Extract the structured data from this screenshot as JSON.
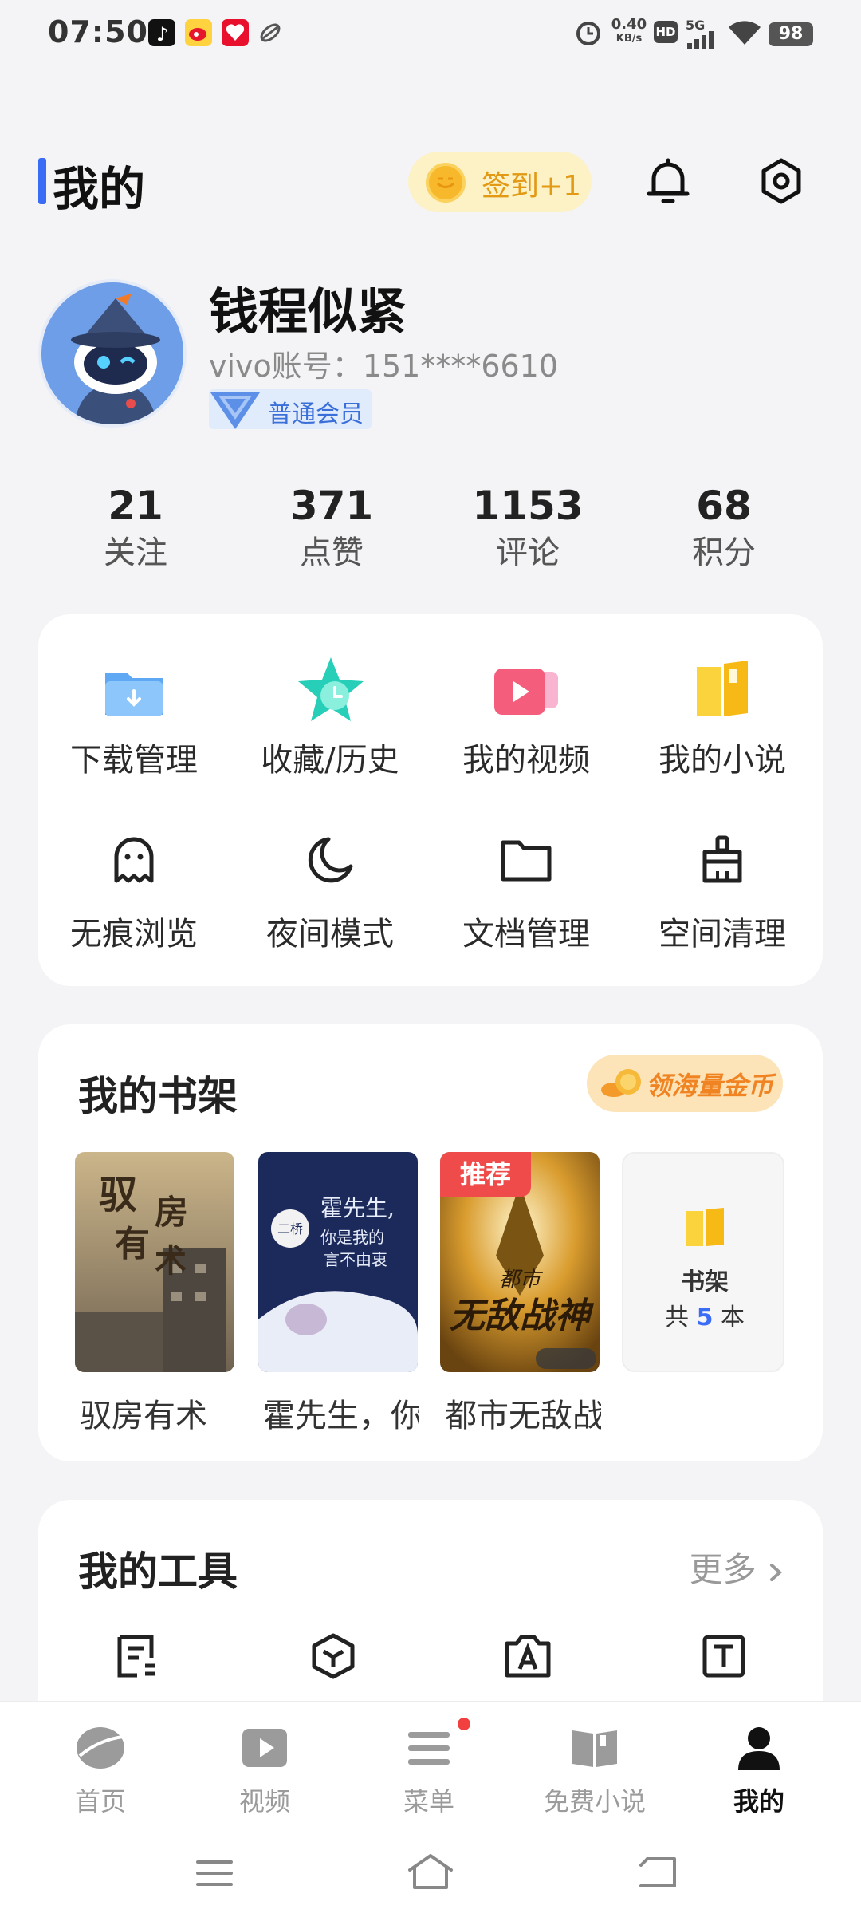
{
  "status_bar": {
    "time": "07:50",
    "net_speed_value": "0.40",
    "net_speed_unit": "KB/s",
    "hd_label": "HD",
    "signal_label": "5G",
    "battery": "98"
  },
  "header": {
    "title": "我的",
    "signin_label": "签到+1"
  },
  "profile": {
    "name": "钱程似紧",
    "account": "vivo账号：151****6610",
    "vip_label": "普通会员"
  },
  "stats": [
    {
      "value": "21",
      "label": "关注"
    },
    {
      "value": "371",
      "label": "点赞"
    },
    {
      "value": "1153",
      "label": "评论"
    },
    {
      "value": "68",
      "label": "积分"
    }
  ],
  "quick_grid": [
    {
      "label": "下载管理",
      "icon": "download-folder-icon"
    },
    {
      "label": "收藏/历史",
      "icon": "star-clock-icon"
    },
    {
      "label": "我的视频",
      "icon": "video-icon"
    },
    {
      "label": "我的小说",
      "icon": "book-icon"
    },
    {
      "label": "无痕浏览",
      "icon": "ghost-icon"
    },
    {
      "label": "夜间模式",
      "icon": "moon-icon"
    },
    {
      "label": "文档管理",
      "icon": "folder-icon"
    },
    {
      "label": "空间清理",
      "icon": "broom-icon"
    }
  ],
  "bookshelf": {
    "title": "我的书架",
    "gold_btn": "领海量金币",
    "books": [
      {
        "title": "驭房有术",
        "cover_text": "驭房有术"
      },
      {
        "title": "霍先生，你是我的言不由衷",
        "cover_text": "霍先生，你是我的言不由衷",
        "cover_author": "二桥"
      },
      {
        "title": "都市无敌战神",
        "cover_text": "都市无敌战神",
        "badge": "推荐",
        "cover_top": "都市",
        "cover_main": "无敌战神"
      }
    ],
    "shelf_card": {
      "title": "书架",
      "prefix": "共",
      "count": "5",
      "suffix": "本"
    }
  },
  "tools": {
    "title": "我的工具",
    "more": "更多"
  },
  "bottom_nav": [
    {
      "label": "首页",
      "icon": "home-leaf-icon"
    },
    {
      "label": "视频",
      "icon": "play-icon"
    },
    {
      "label": "菜单",
      "icon": "menu-icon"
    },
    {
      "label": "免费小说",
      "icon": "open-book-icon"
    },
    {
      "label": "我的",
      "icon": "person-icon",
      "active": true
    }
  ],
  "colors": {
    "accent": "#3b6cf6",
    "signin_bg": "#fdf1c6",
    "signin_text": "#e29a14",
    "badge_red": "#f04b4b"
  }
}
